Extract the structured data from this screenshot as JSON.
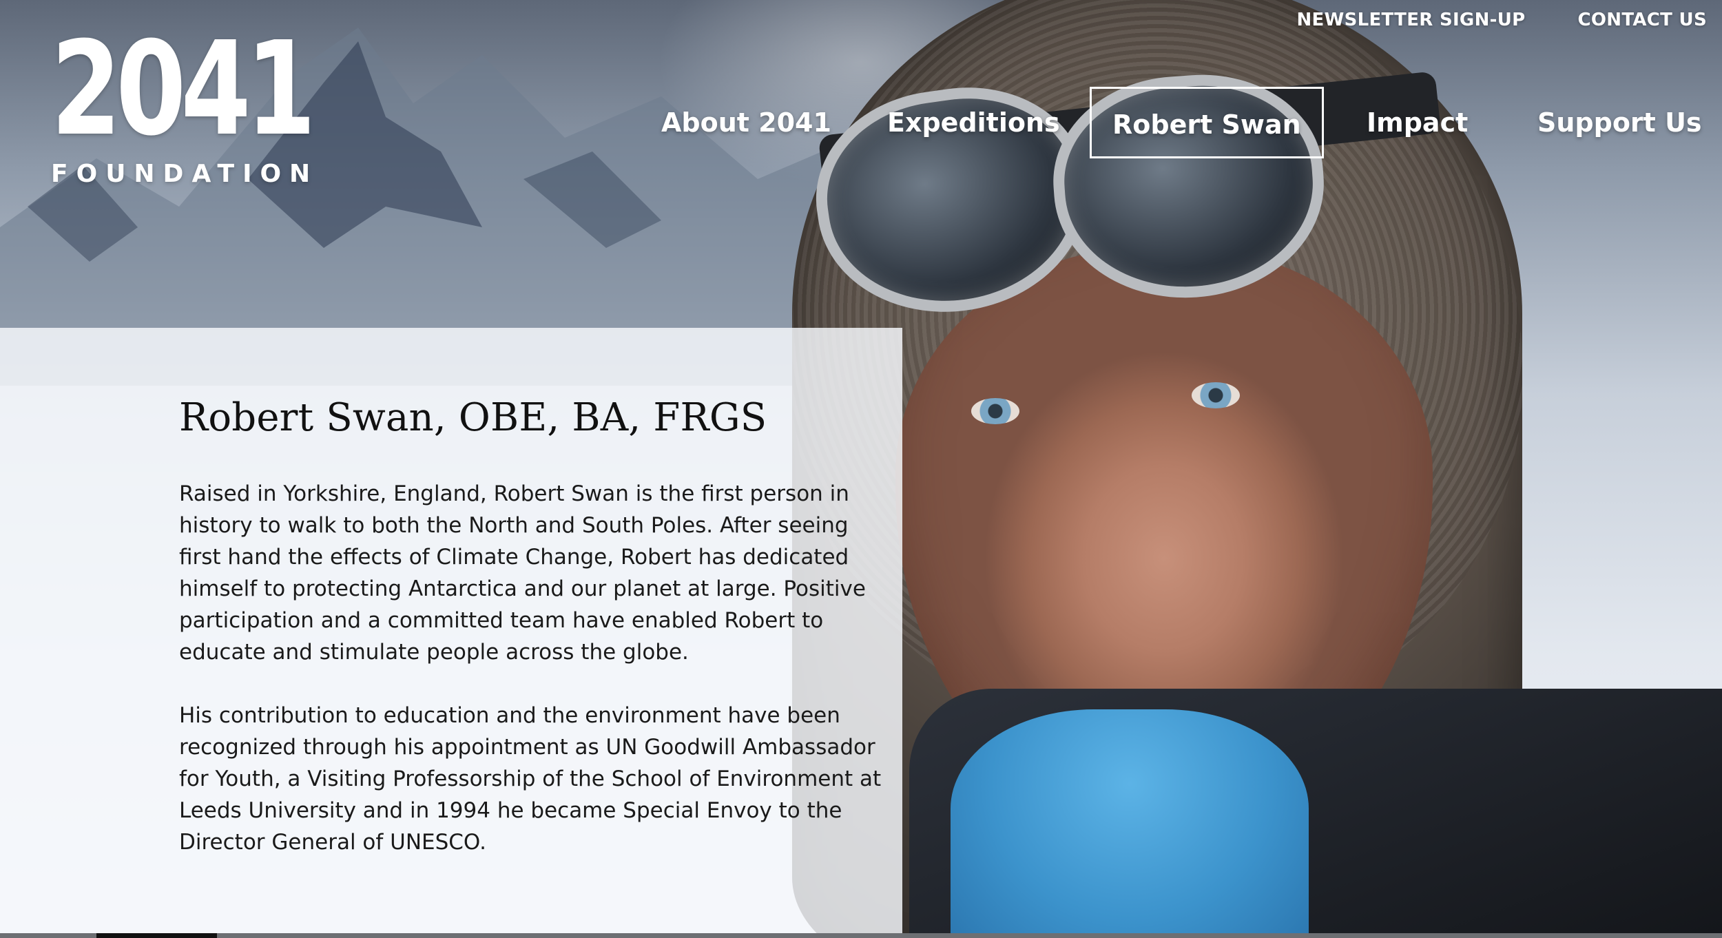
{
  "logo": {
    "number": "2041",
    "word": "FOUNDATION"
  },
  "utility_nav": [
    {
      "label": "NEWSLETTER SIGN-UP"
    },
    {
      "label": "CONTACT US"
    }
  ],
  "main_nav": [
    {
      "label": "About 2041",
      "active": false
    },
    {
      "label": "Expeditions",
      "active": false
    },
    {
      "label": "Robert Swan",
      "active": true
    },
    {
      "label": "Impact",
      "active": false
    },
    {
      "label": "Support Us",
      "active": false
    }
  ],
  "profile": {
    "name": "Robert Swan, OBE, BA, FRGS",
    "bio": [
      "Raised in Yorkshire, England, Robert Swan is the first person in history to walk to both the North and South Poles. After seeing first hand the effects of Climate Change, Robert has dedicated himself to protecting Antarctica and our planet at large. Positive participation and a committed team have enabled Robert to educate and stimulate people across the globe.",
      "His contribution to education and the environment have been recognized through his appointment as UN Goodwill Ambassador for Youth, a Visiting Professorship of the School of Environment at Leeds University and in 1994 he became Special Envoy to the Director General of UNESCO."
    ]
  },
  "colors": {
    "nav_text": "#ffffff",
    "panel_bg": "#f6f8fb",
    "body_text": "#1a1a1a"
  }
}
